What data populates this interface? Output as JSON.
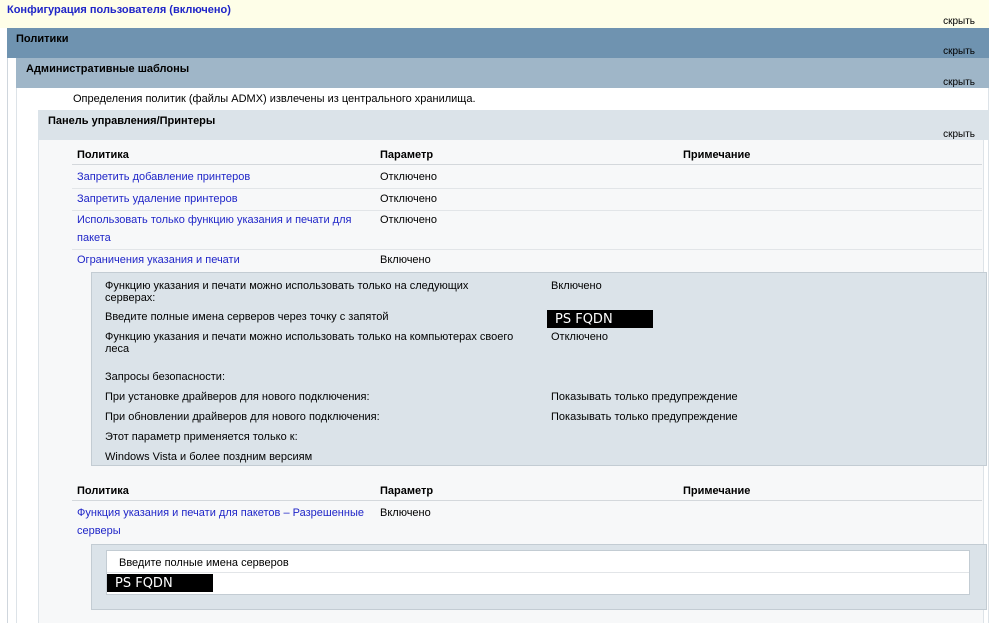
{
  "header": {
    "title": "Конфигурация пользователя (включено)",
    "hide": "скрыть"
  },
  "policies": {
    "title": "Политики",
    "hide": "скрыть"
  },
  "admin_templates": {
    "title": "Административные шаблоны",
    "hide": "скрыть",
    "note": "Определения политик (файлы ADMX) извлечены из центрального хранилища."
  },
  "control_panel": {
    "title": "Панель управления/Принтеры",
    "hide": "скрыть"
  },
  "table1": {
    "headers": [
      "Политика",
      "Параметр",
      "Примечание"
    ],
    "rows": [
      {
        "policy": "Запретить добавление принтеров",
        "value": "Отключено"
      },
      {
        "policy": "Запретить удаление принтеров",
        "value": "Отключено"
      },
      {
        "policy_line1": "Использовать только функцию указания и печати для",
        "policy_line2": "пакета",
        "value": "Отключено"
      },
      {
        "policy": "Ограничения указания и печати",
        "value": "Включено"
      }
    ]
  },
  "details": {
    "r1_label_1": "Функцию указания и печати можно использовать только на следующих",
    "r1_label_2": "серверах:",
    "r1_value": "Включено",
    "r2_label": "Введите полные имена серверов через точку с запятой",
    "r2_value": "PS FQDN",
    "r3_label_1": "Функцию указания и печати можно использовать только на компьютерах своего",
    "r3_label_2": "леса",
    "r3_value": "Отключено",
    "r4_label": "Запросы безопасности:",
    "r5_label": "При установке драйверов для нового подключения:",
    "r5_value": "Показывать только предупреждение",
    "r6_label": "При обновлении драйверов для нового подключения:",
    "r6_value": "Показывать только предупреждение",
    "r7_label": "Этот параметр применяется только к:",
    "r8_label": "Windows Vista и более поздним версиям"
  },
  "table2": {
    "headers": [
      "Политика",
      "Параметр",
      "Примечание"
    ],
    "policy_line1": "Функция указания и печати для пакетов – Разрешенные",
    "policy_line2": "серверы",
    "value": "Включено",
    "inner_label": "Введите полные имена серверов",
    "inner_value": "PS FQDN"
  }
}
